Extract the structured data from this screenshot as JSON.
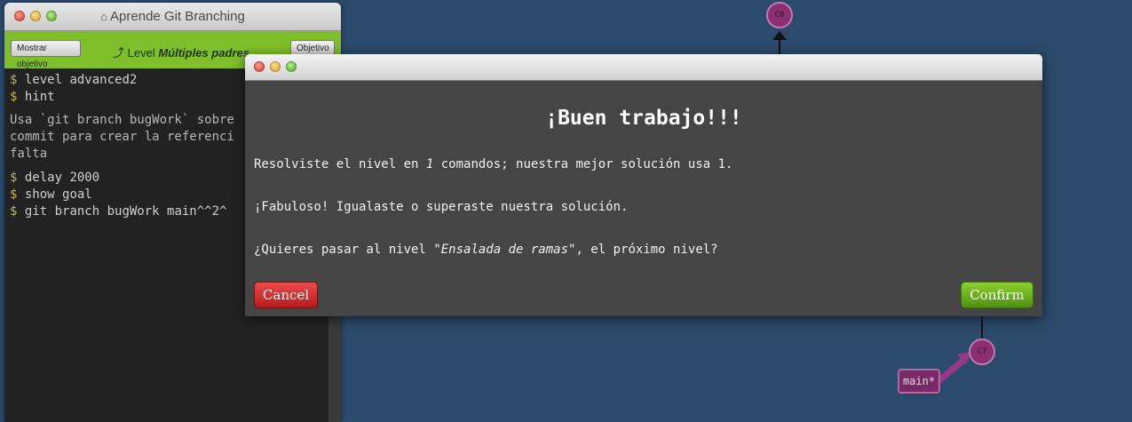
{
  "terminal": {
    "title": "Aprende Git Branching",
    "home_icon": "home-icon",
    "show_goal_label": "Mostrar objetivo",
    "level_prefix": "Level",
    "level_name": "Múltiples padres",
    "goal_label": "Objetivo",
    "commands_top": [
      "level advanced2",
      "hint"
    ],
    "hint_text": "Usa `git branch bugWork` sobre\ncommit para crear la referenci\nfalta",
    "commands_bottom": [
      "delay 2000",
      "show goal",
      "git branch bugWork main^^2^"
    ],
    "prompt": "$"
  },
  "tree": {
    "node_top": "C0",
    "node_bottom": "C7",
    "branch_label": "main*",
    "node_color": "#8b2e74"
  },
  "modal": {
    "heading": "¡Buen trabajo!!!",
    "line1_a": "Resolviste el nivel en ",
    "line1_count": "1",
    "line1_b": " comandos; nuestra mejor solución usa 1.",
    "line2": "¡Fabuloso! Igualaste o superaste nuestra solución.",
    "line3_a": "¿Quieres pasar al nivel ",
    "line3_level": "\"Ensalada de ramas\"",
    "line3_b": ", el próximo nivel?",
    "cancel_label": "Cancel",
    "confirm_label": "Confirm"
  },
  "colors": {
    "background": "#2c4b6c",
    "level_bar": "#7fbf2b",
    "cancel": "#d33030",
    "confirm": "#6fb41e"
  }
}
